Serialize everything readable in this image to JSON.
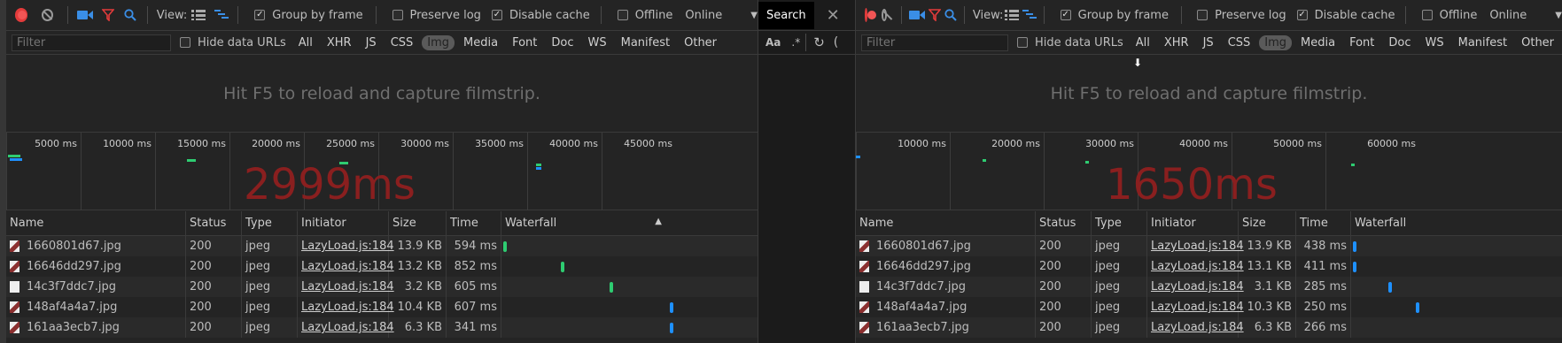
{
  "colors": {
    "accent": "#e33b3b",
    "waterfall_green": "#2ecc71",
    "waterfall_blue": "#1e90ff",
    "big_time": "#8a1f1f"
  },
  "toolbar": {
    "view_label": "View:",
    "group_by_frame": "Group by frame",
    "preserve_log": "Preserve log",
    "disable_cache": "Disable cache",
    "offline": "Offline",
    "throttle": "Online",
    "group_checked": true,
    "preserve_checked": false,
    "disable_checked": true,
    "offline_checked": false
  },
  "filterbar": {
    "placeholder": "Filter",
    "hide_data_urls": "Hide data URLs",
    "types": [
      "All",
      "XHR",
      "JS",
      "CSS",
      "Img",
      "Media",
      "Font",
      "Doc",
      "WS",
      "Manifest",
      "Other"
    ],
    "active_type": "Img"
  },
  "filmstrip_msg": "Hit F5 to reload and capture filmstrip.",
  "columns": {
    "name": "Name",
    "status": "Status",
    "type": "Type",
    "initiator": "Initiator",
    "size": "Size",
    "time": "Time",
    "waterfall": "Waterfall"
  },
  "search": {
    "label": "Search",
    "match_case": "Aa",
    "regex": ".*"
  },
  "left": {
    "load_time": "2999ms",
    "ticks": [
      "5000 ms",
      "10000 ms",
      "15000 ms",
      "20000 ms",
      "25000 ms",
      "30000 ms",
      "35000 ms",
      "40000 ms",
      "45000 ms"
    ],
    "rows": [
      {
        "name": "1660801d67.jpg",
        "status": "200",
        "type": "jpeg",
        "initiator": "LazyLoad.js:184",
        "size": "13.9 KB",
        "time": "594 ms"
      },
      {
        "name": "16646dd297.jpg",
        "status": "200",
        "type": "jpeg",
        "initiator": "LazyLoad.js:184",
        "size": "13.2 KB",
        "time": "852 ms"
      },
      {
        "name": "14c3f7ddc7.jpg",
        "status": "200",
        "type": "jpeg",
        "initiator": "LazyLoad.js:184",
        "size": "3.2 KB",
        "time": "605 ms"
      },
      {
        "name": "148af4a4a7.jpg",
        "status": "200",
        "type": "jpeg",
        "initiator": "LazyLoad.js:184",
        "size": "10.4 KB",
        "time": "607 ms"
      },
      {
        "name": "161aa3ecb7.jpg",
        "status": "200",
        "type": "jpeg",
        "initiator": "LazyLoad.js:184",
        "size": "6.3 KB",
        "time": "341 ms"
      }
    ]
  },
  "right": {
    "load_time": "1650ms",
    "ticks": [
      "10000 ms",
      "20000 ms",
      "30000 ms",
      "40000 ms",
      "50000 ms",
      "60000 ms"
    ],
    "rows": [
      {
        "name": "1660801d67.jpg",
        "status": "200",
        "type": "jpeg",
        "initiator": "LazyLoad.js:184",
        "size": "13.9 KB",
        "time": "438 ms"
      },
      {
        "name": "16646dd297.jpg",
        "status": "200",
        "type": "jpeg",
        "initiator": "LazyLoad.js:184",
        "size": "13.1 KB",
        "time": "411 ms"
      },
      {
        "name": "14c3f7ddc7.jpg",
        "status": "200",
        "type": "jpeg",
        "initiator": "LazyLoad.js:184",
        "size": "3.1 KB",
        "time": "285 ms"
      },
      {
        "name": "148af4a4a7.jpg",
        "status": "200",
        "type": "jpeg",
        "initiator": "LazyLoad.js:184",
        "size": "10.3 KB",
        "time": "250 ms"
      },
      {
        "name": "161aa3ecb7.jpg",
        "status": "200",
        "type": "jpeg",
        "initiator": "LazyLoad.js:184",
        "size": "6.3 KB",
        "time": "266 ms"
      }
    ]
  }
}
